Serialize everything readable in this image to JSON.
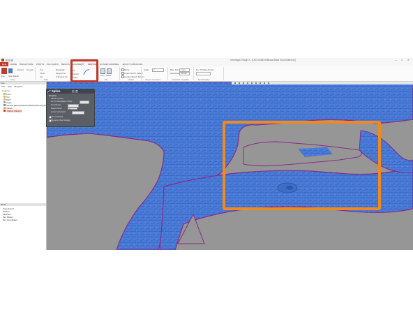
{
  "window": {
    "title": "Geomagic Design X - [LNG-Detail Driftwood Base Scan-Edited.xrl]",
    "minimize_glyph": "—",
    "maximize_glyph": "□",
    "close_glyph": "✕"
  },
  "tabs": {
    "file": "FILE",
    "items": [
      "HOME",
      "INSCAPTURE",
      "POINTS",
      "POLYGONS",
      "REGION",
      "ALIGNMENT",
      "SKETCH",
      "3D SKETCH",
      "MODEL",
      "EXACT SURFACING"
    ],
    "active": "SKETCH"
  },
  "ribbon": {
    "setup": {
      "exit_label": "Exit",
      "new_sketch_label": "New Sketch",
      "extract_label": "Extract",
      "smooth_label": "Smooth",
      "group_label": "Setup"
    },
    "draw": {
      "line": "Line",
      "rectangle": "Rectangle",
      "circle": "Circle",
      "arc": "Arc",
      "tangent_arc": "Tangent Arc",
      "three_tangent_circle": "3 Tangent Cir.",
      "group_label": "Draw"
    },
    "draw2": {
      "fit": "Fit",
      "extract": "Extract",
      "spline": "Spline"
    },
    "tools": {
      "trim": "Trim",
      "offset": "Offset",
      "convert_entities": "Convert Entities",
      "group_label": "Edit"
    },
    "pattern": {
      "mirror": "Mirror",
      "linear_pattern": "Linear Sketch Pattern",
      "circular_pattern": "Circular Sketch Pattern",
      "group_label": "Pattern"
    },
    "tangent": {
      "angle_label": "Angle",
      "angle_value": "2",
      "group_label": "Tangent Constraint"
    },
    "coincident": {
      "max_dev_label": "Max. Dvd.",
      "max_dev_value": "1 mm",
      "intersection_label": "Intersection",
      "intersection_value": "0.5 mm",
      "group_label": "Coincident Constraint"
    },
    "spline": {
      "points_label": "No. Of Spline Points",
      "group_label": "Retrofit Spline"
    }
  },
  "left_panel": {
    "header": "Tree",
    "tabs": [
      "Tree",
      "Help",
      "Viewpoint"
    ],
    "section": "Features",
    "items": [
      "Front",
      "Top",
      "Right",
      "Origin",
      "Sketch4 (Sketch)(Sketch)(Sketch)(Sketch)(Sk...",
      "Plane1",
      "Spline1 (Sketch)"
    ],
    "model_header": "Model",
    "model_items": [
      "Scan shared",
      "Meshes",
      "Sketches",
      "Ref. Planes",
      "Ref. Coordinates"
    ]
  },
  "spline_dialog": {
    "title": "Spline",
    "header": "Fit Spline",
    "sub": "Sketch Contour",
    "control_points_label": "No. Of Interpolation Points",
    "control_points_value": "",
    "smoothness_label": "Smoothness",
    "range_label": "Range Factor",
    "range_value": "2",
    "loose_label": "Loose Constraints",
    "option_label": "Fit Constraints",
    "option2_label": "Dynamic View Strategy"
  }
}
